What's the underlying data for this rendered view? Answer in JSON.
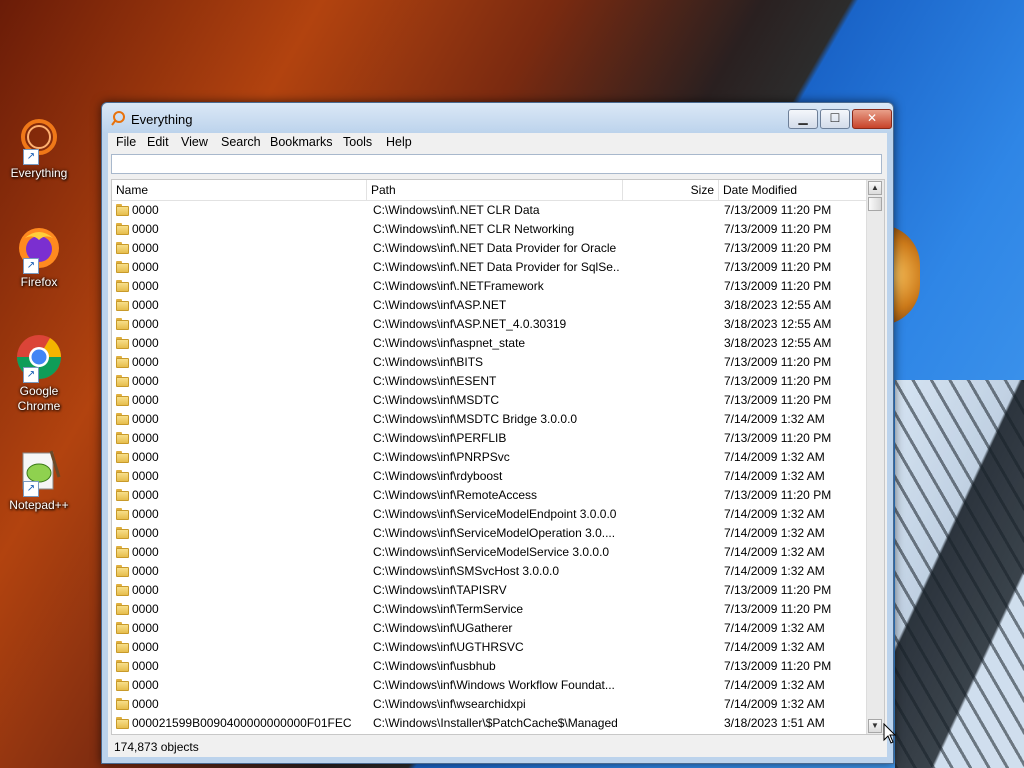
{
  "desktop": {
    "icons": [
      {
        "label": "Everything",
        "icon": "everything-icon"
      },
      {
        "label": "Firefox",
        "icon": "firefox-icon"
      },
      {
        "label": "Google Chrome",
        "icon": "chrome-icon"
      },
      {
        "label": "Notepad++",
        "icon": "notepadpp-icon"
      }
    ]
  },
  "window": {
    "title": "Everything",
    "controls": {
      "minimize": "minimize-icon",
      "maximize": "maximize-icon",
      "close": "close-icon"
    }
  },
  "menu": [
    "File",
    "Edit",
    "View",
    "Search",
    "Bookmarks",
    "Tools",
    "Help"
  ],
  "search": {
    "value": "",
    "placeholder": ""
  },
  "columns": {
    "name": "Name",
    "path": "Path",
    "size": "Size",
    "date": "Date Modified"
  },
  "rows": [
    {
      "name": "0000",
      "path": "C:\\Windows\\inf\\.NET CLR Data",
      "size": "",
      "date": "7/13/2009 11:20 PM"
    },
    {
      "name": "0000",
      "path": "C:\\Windows\\inf\\.NET CLR Networking",
      "size": "",
      "date": "7/13/2009 11:20 PM"
    },
    {
      "name": "0000",
      "path": "C:\\Windows\\inf\\.NET Data Provider for Oracle",
      "size": "",
      "date": "7/13/2009 11:20 PM"
    },
    {
      "name": "0000",
      "path": "C:\\Windows\\inf\\.NET Data Provider for SqlSe...",
      "size": "",
      "date": "7/13/2009 11:20 PM"
    },
    {
      "name": "0000",
      "path": "C:\\Windows\\inf\\.NETFramework",
      "size": "",
      "date": "7/13/2009 11:20 PM"
    },
    {
      "name": "0000",
      "path": "C:\\Windows\\inf\\ASP.NET",
      "size": "",
      "date": "3/18/2023 12:55 AM"
    },
    {
      "name": "0000",
      "path": "C:\\Windows\\inf\\ASP.NET_4.0.30319",
      "size": "",
      "date": "3/18/2023 12:55 AM"
    },
    {
      "name": "0000",
      "path": "C:\\Windows\\inf\\aspnet_state",
      "size": "",
      "date": "3/18/2023 12:55 AM"
    },
    {
      "name": "0000",
      "path": "C:\\Windows\\inf\\BITS",
      "size": "",
      "date": "7/13/2009 11:20 PM"
    },
    {
      "name": "0000",
      "path": "C:\\Windows\\inf\\ESENT",
      "size": "",
      "date": "7/13/2009 11:20 PM"
    },
    {
      "name": "0000",
      "path": "C:\\Windows\\inf\\MSDTC",
      "size": "",
      "date": "7/13/2009 11:20 PM"
    },
    {
      "name": "0000",
      "path": "C:\\Windows\\inf\\MSDTC Bridge 3.0.0.0",
      "size": "",
      "date": "7/14/2009 1:32 AM"
    },
    {
      "name": "0000",
      "path": "C:\\Windows\\inf\\PERFLIB",
      "size": "",
      "date": "7/13/2009 11:20 PM"
    },
    {
      "name": "0000",
      "path": "C:\\Windows\\inf\\PNRPSvc",
      "size": "",
      "date": "7/14/2009 1:32 AM"
    },
    {
      "name": "0000",
      "path": "C:\\Windows\\inf\\rdyboost",
      "size": "",
      "date": "7/14/2009 1:32 AM"
    },
    {
      "name": "0000",
      "path": "C:\\Windows\\inf\\RemoteAccess",
      "size": "",
      "date": "7/13/2009 11:20 PM"
    },
    {
      "name": "0000",
      "path": "C:\\Windows\\inf\\ServiceModelEndpoint 3.0.0.0",
      "size": "",
      "date": "7/14/2009 1:32 AM"
    },
    {
      "name": "0000",
      "path": "C:\\Windows\\inf\\ServiceModelOperation 3.0....",
      "size": "",
      "date": "7/14/2009 1:32 AM"
    },
    {
      "name": "0000",
      "path": "C:\\Windows\\inf\\ServiceModelService 3.0.0.0",
      "size": "",
      "date": "7/14/2009 1:32 AM"
    },
    {
      "name": "0000",
      "path": "C:\\Windows\\inf\\SMSvcHost 3.0.0.0",
      "size": "",
      "date": "7/14/2009 1:32 AM"
    },
    {
      "name": "0000",
      "path": "C:\\Windows\\inf\\TAPISRV",
      "size": "",
      "date": "7/13/2009 11:20 PM"
    },
    {
      "name": "0000",
      "path": "C:\\Windows\\inf\\TermService",
      "size": "",
      "date": "7/13/2009 11:20 PM"
    },
    {
      "name": "0000",
      "path": "C:\\Windows\\inf\\UGatherer",
      "size": "",
      "date": "7/14/2009 1:32 AM"
    },
    {
      "name": "0000",
      "path": "C:\\Windows\\inf\\UGTHRSVC",
      "size": "",
      "date": "7/14/2009 1:32 AM"
    },
    {
      "name": "0000",
      "path": "C:\\Windows\\inf\\usbhub",
      "size": "",
      "date": "7/13/2009 11:20 PM"
    },
    {
      "name": "0000",
      "path": "C:\\Windows\\inf\\Windows Workflow Foundat...",
      "size": "",
      "date": "7/14/2009 1:32 AM"
    },
    {
      "name": "0000",
      "path": "C:\\Windows\\inf\\wsearchidxpi",
      "size": "",
      "date": "7/14/2009 1:32 AM"
    },
    {
      "name": "000021599B0090400000000000F01FEC",
      "path": "C:\\Windows\\Installer\\$PatchCache$\\Managed",
      "size": "",
      "date": "3/18/2023 1:51 AM"
    }
  ],
  "status": {
    "text": "174,873 objects"
  },
  "scrollbar": {
    "up_icon": "scroll-up-icon",
    "down_icon": "scroll-down-icon"
  }
}
